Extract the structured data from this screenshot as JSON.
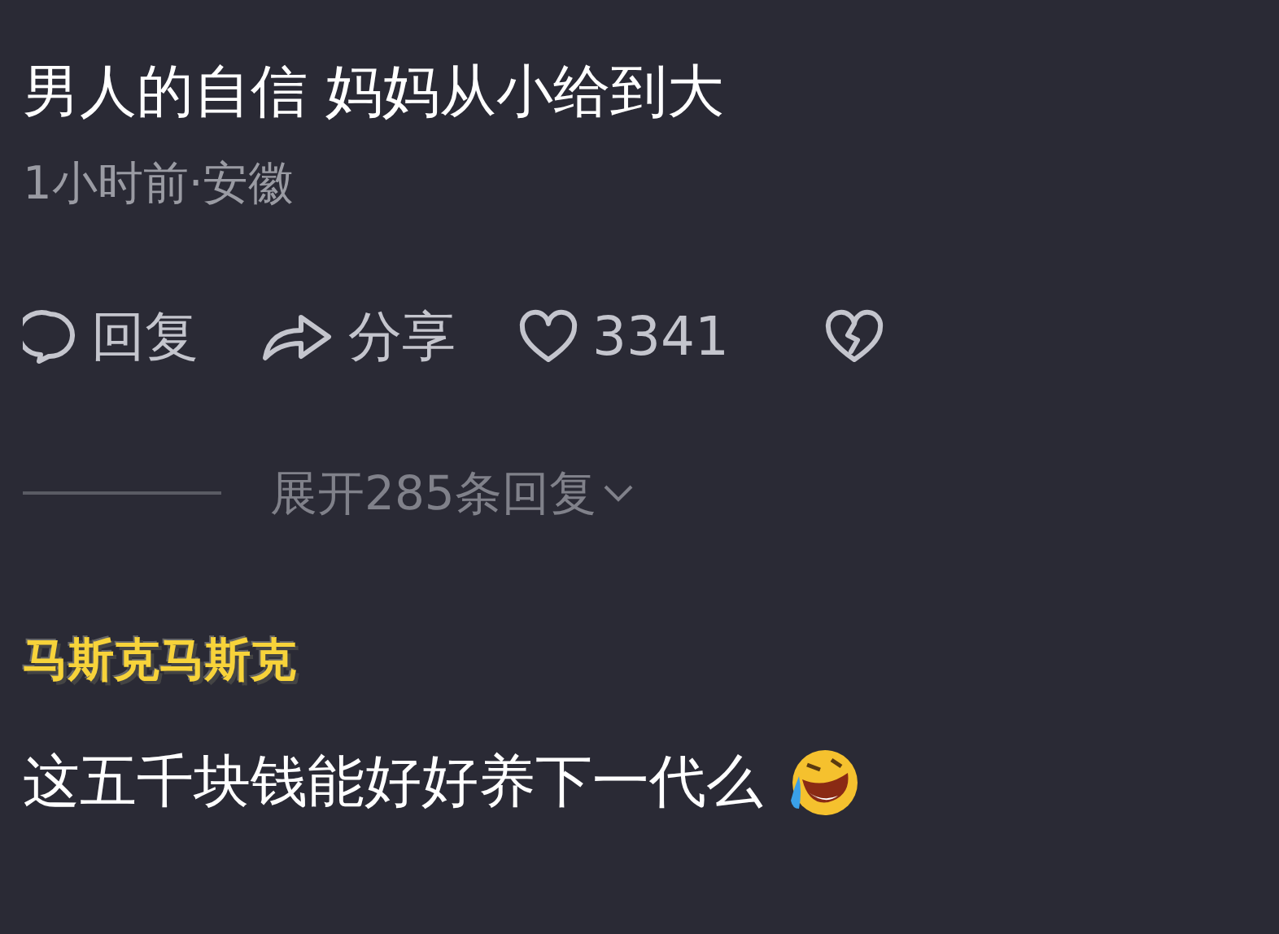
{
  "comment": {
    "text": "男人的自信 妈妈从小给到大",
    "meta": "1小时前·安徽",
    "actions": [
      {
        "kind": "reply",
        "label": "回复"
      },
      {
        "kind": "share",
        "label": "分享"
      },
      {
        "kind": "like",
        "label": "3341"
      },
      {
        "kind": "dislike"
      }
    ],
    "expand": "展开285条回复"
  },
  "reply": {
    "username": "马斯克马斯克",
    "text": "这五千块钱能好好养下一代么"
  }
}
